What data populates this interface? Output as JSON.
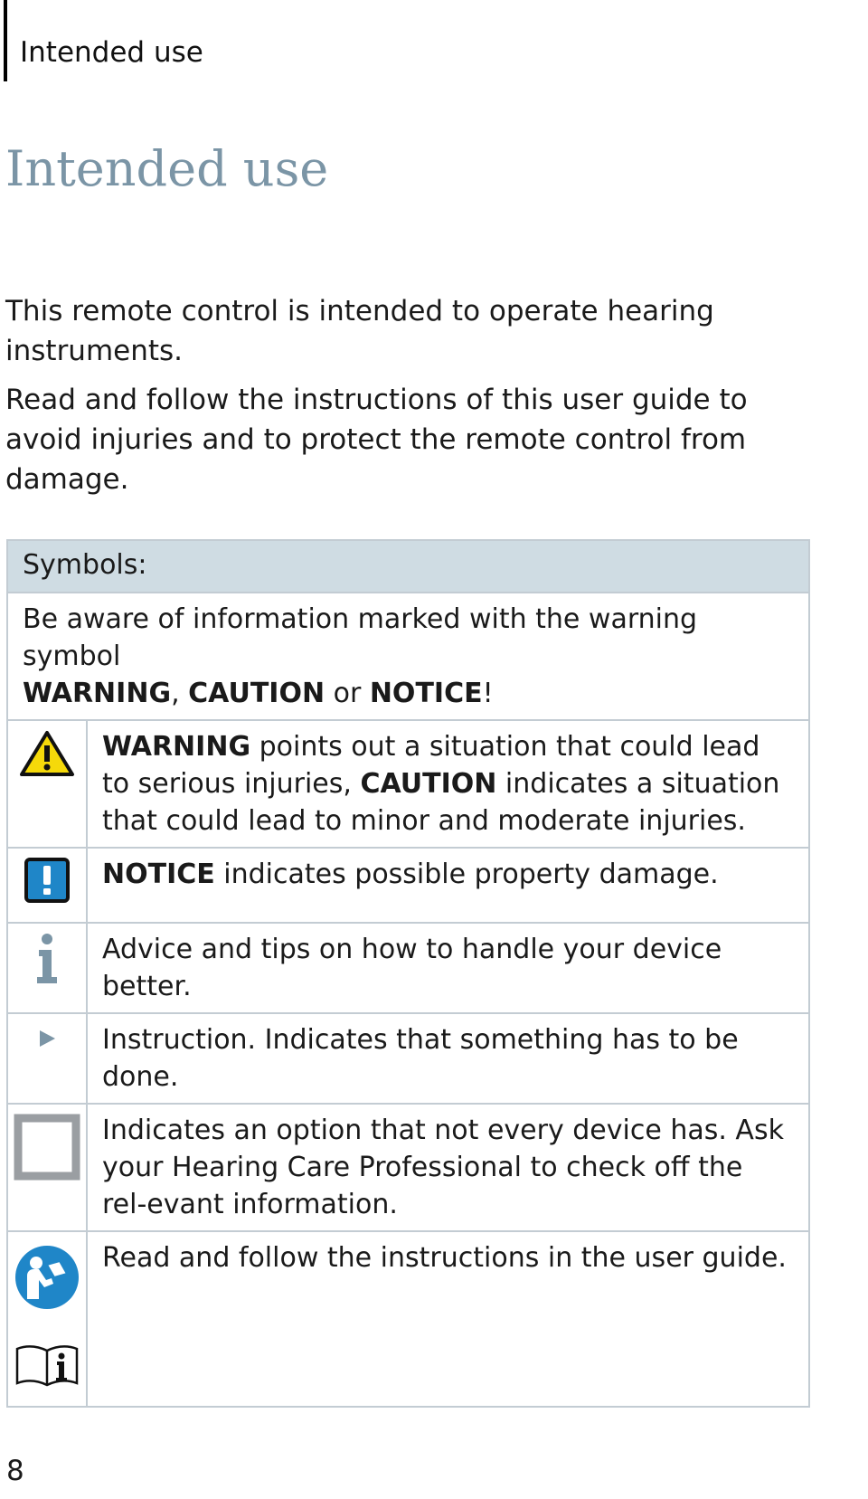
{
  "running_header": "Intended use",
  "page_title": "Intended use",
  "intro": [
    "This remote control is intended to operate hearing instruments.",
    "Read and follow the instructions of this user guide to avoid injuries and to protect the remote control from damage."
  ],
  "symbols": {
    "header": "Symbols:",
    "lead_text": "Be aware of information marked with the warning symbol",
    "lead_w": "WARNING",
    "lead_sep1": ", ",
    "lead_c": "CAUTION",
    "lead_or": " or ",
    "lead_n": "NOTICE",
    "lead_end": "!",
    "rows": [
      {
        "icon": "warning-triangle-icon",
        "bold1": "WARNING",
        "t1": " points out a situation that could lead to serious injuries, ",
        "bold2": "CAUTION",
        "t2": " indicates a situation that could lead to minor and moderate injuries."
      },
      {
        "icon": "notice-exclamation-icon",
        "bold1": "NOTICE",
        "t1": " indicates possible property damage."
      },
      {
        "icon": "info-icon",
        "t1": "Advice and tips on how to handle your device better."
      },
      {
        "icon": "play-arrow-icon",
        "t1": "Instruction. Indicates that something has to be done."
      },
      {
        "icon": "checkbox-icon",
        "t1": "Indicates an option that not every device has. Ask your Hearing Care Professional to check off the rel-evant information."
      },
      {
        "icon": "read-manual-icon",
        "t1": "Read and follow the instructions in the user guide."
      }
    ]
  },
  "colors": {
    "title": "#7b95a6",
    "header_bg": "#cfdce3",
    "warning_yellow": "#f5d90a",
    "notice_blue": "#1f86c8",
    "info_gray": "#7b95a6"
  },
  "page_number": "8"
}
